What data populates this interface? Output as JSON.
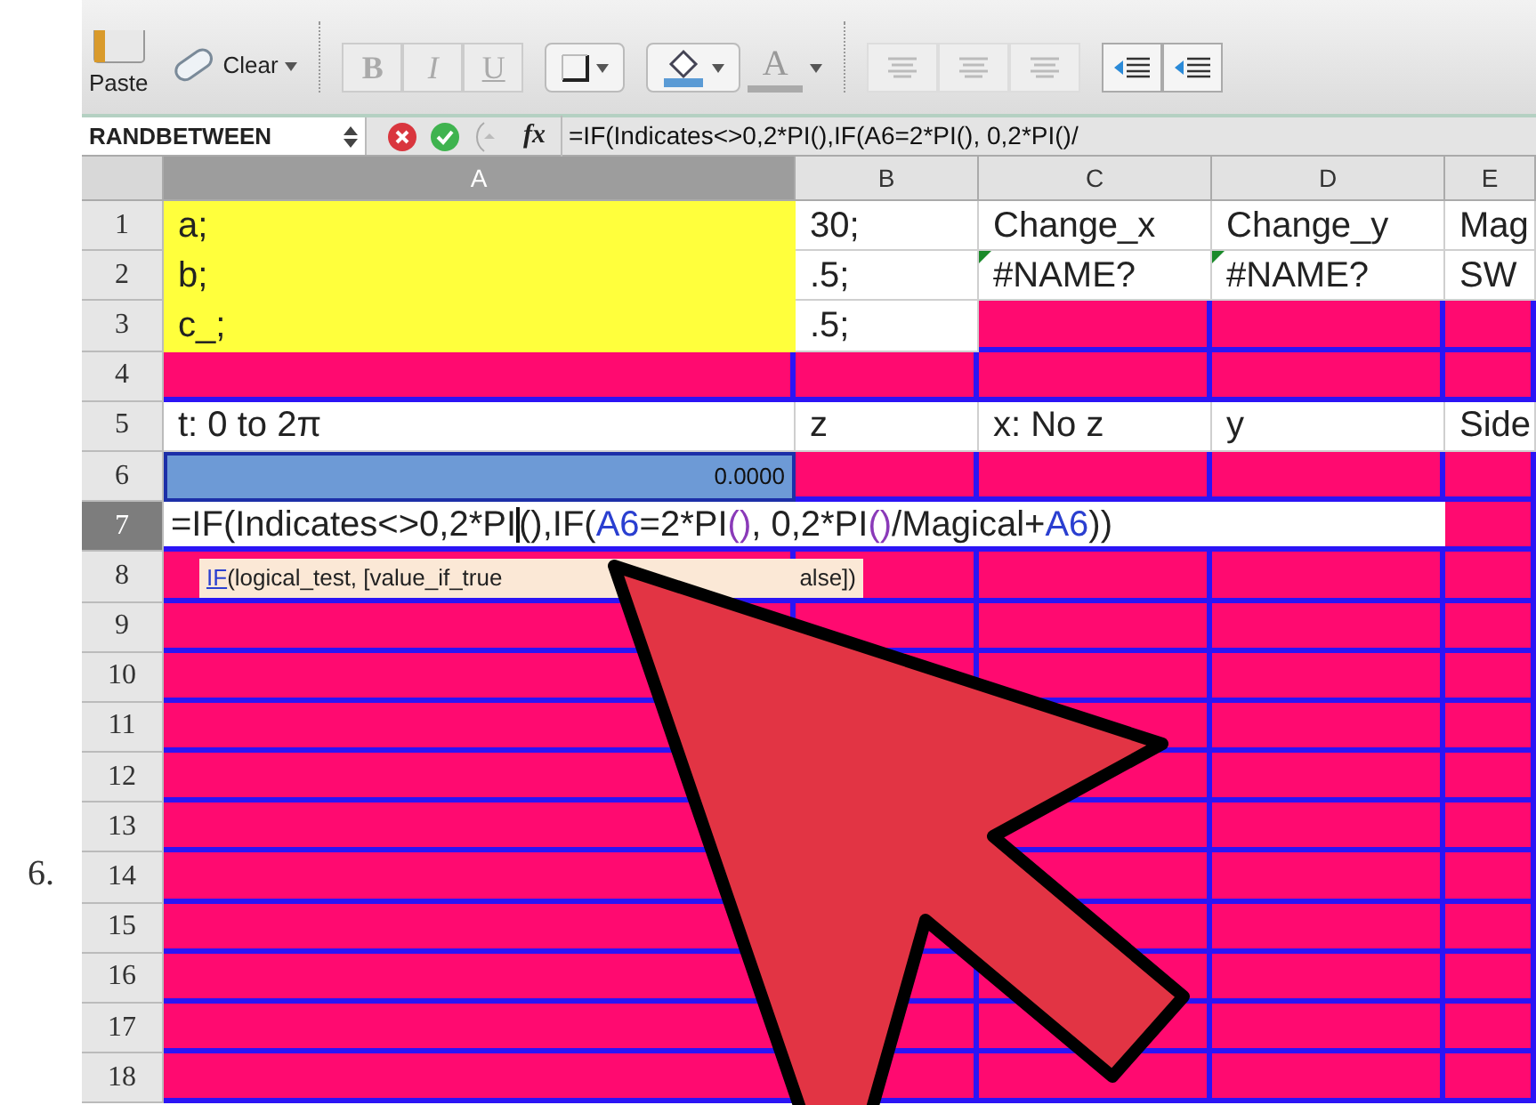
{
  "step": {
    "label": "6."
  },
  "toolbar": {
    "paste": {
      "label": "Paste"
    },
    "clear": {
      "label": "Clear"
    },
    "format_buttons": [
      "B",
      "I",
      "U"
    ],
    "font_color": {
      "label": "A"
    }
  },
  "formula_bar": {
    "name_box": "RANDBETWEEN",
    "fx": "fx",
    "formula": "=IF(Indicates<>0,2*PI(),IF(A6=2*PI(), 0,2*PI()/"
  },
  "columns": [
    {
      "label": "A",
      "selected": true
    },
    {
      "label": "B",
      "selected": false
    },
    {
      "label": "C",
      "selected": false
    },
    {
      "label": "D",
      "selected": false
    },
    {
      "label": "E",
      "selected": false
    }
  ],
  "rows": [
    {
      "number": "1",
      "selected": false,
      "cells": [
        {
          "kind": "yellow",
          "text": "a;",
          "flag": false
        },
        {
          "kind": "plain",
          "text": "30;",
          "flag": false
        },
        {
          "kind": "plain",
          "text": "Change_x",
          "flag": false
        },
        {
          "kind": "plain",
          "text": "Change_y",
          "flag": false
        },
        {
          "kind": "plain",
          "text": "Mag",
          "flag": false
        }
      ]
    },
    {
      "number": "2",
      "selected": false,
      "cells": [
        {
          "kind": "yellow",
          "text": "b;",
          "flag": false
        },
        {
          "kind": "plain",
          "text": ".5;",
          "flag": false
        },
        {
          "kind": "plain",
          "text": "#NAME?",
          "flag": true
        },
        {
          "kind": "plain",
          "text": "#NAME?",
          "flag": true
        },
        {
          "kind": "plain",
          "text": "SW",
          "flag": false
        }
      ]
    },
    {
      "number": "3",
      "selected": false,
      "cells": [
        {
          "kind": "yellow",
          "text": "c_;",
          "flag": false
        },
        {
          "kind": "plain",
          "text": ".5;",
          "flag": false
        },
        {
          "kind": "pink"
        },
        {
          "kind": "pink"
        },
        {
          "kind": "pink"
        }
      ]
    },
    {
      "number": "4",
      "selected": false,
      "cells": [
        {
          "kind": "pink"
        },
        {
          "kind": "pink"
        },
        {
          "kind": "pink"
        },
        {
          "kind": "pink"
        },
        {
          "kind": "pink"
        }
      ]
    },
    {
      "number": "5",
      "selected": false,
      "cells": [
        {
          "kind": "plain",
          "text": "t: 0 to 2π",
          "flag": false
        },
        {
          "kind": "plain",
          "text": "z",
          "flag": false
        },
        {
          "kind": "plain",
          "text": "x: No z",
          "flag": false
        },
        {
          "kind": "plain",
          "text": "y",
          "flag": false
        },
        {
          "kind": "plain",
          "text": "Side",
          "flag": false
        }
      ]
    },
    {
      "number": "6",
      "selected": false,
      "cells": [
        {
          "kind": "selected",
          "text": "0.0000"
        },
        {
          "kind": "pink"
        },
        {
          "kind": "pink"
        },
        {
          "kind": "pink"
        },
        {
          "kind": "pink"
        }
      ]
    },
    {
      "number": "7",
      "selected": true,
      "cells": [
        {
          "kind": "editor",
          "segments": [
            {
              "text": "=IF(Indicates<>0,2*PI",
              "kind": "plain"
            },
            {
              "kind": "cursor"
            },
            {
              "text": "(),IF(",
              "kind": "plain"
            },
            {
              "text": "A6",
              "kind": "ref"
            },
            {
              "text": "=2*PI",
              "kind": "plain"
            },
            {
              "text": "()",
              "kind": "paren"
            },
            {
              "text": ", 0,2*PI",
              "kind": "plain"
            },
            {
              "text": "()",
              "kind": "paren"
            },
            {
              "text": "/Magical+",
              "kind": "plain"
            },
            {
              "text": "A6",
              "kind": "ref"
            },
            {
              "text": "))",
              "kind": "plain"
            }
          ]
        },
        {
          "kind": "pink"
        }
      ]
    },
    {
      "number": "8",
      "selected": false,
      "cells": [
        {
          "kind": "pink"
        },
        {
          "kind": "pink"
        },
        {
          "kind": "pink"
        },
        {
          "kind": "pink"
        },
        {
          "kind": "pink"
        }
      ]
    },
    {
      "number": "9",
      "selected": false,
      "cells": [
        {
          "kind": "pink"
        },
        {
          "kind": "pink"
        },
        {
          "kind": "pink"
        },
        {
          "kind": "pink"
        },
        {
          "kind": "pink"
        }
      ]
    },
    {
      "number": "10",
      "selected": false,
      "cells": [
        {
          "kind": "pink"
        },
        {
          "kind": "pink"
        },
        {
          "kind": "pink"
        },
        {
          "kind": "pink"
        },
        {
          "kind": "pink"
        }
      ]
    },
    {
      "number": "11",
      "selected": false,
      "cells": [
        {
          "kind": "pink"
        },
        {
          "kind": "covered"
        },
        {
          "kind": "pink"
        },
        {
          "kind": "pink"
        },
        {
          "kind": "pink"
        }
      ]
    },
    {
      "number": "12",
      "selected": false,
      "cells": [
        {
          "kind": "pink"
        },
        {
          "kind": "covered"
        },
        {
          "kind": "pink"
        },
        {
          "kind": "pink"
        },
        {
          "kind": "pink"
        }
      ]
    },
    {
      "number": "13",
      "selected": false,
      "cells": [
        {
          "kind": "pink"
        },
        {
          "kind": "covered"
        },
        {
          "kind": "pink"
        },
        {
          "kind": "pink"
        },
        {
          "kind": "pink"
        }
      ]
    },
    {
      "number": "14",
      "selected": false,
      "cells": [
        {
          "kind": "pink"
        },
        {
          "kind": "covered"
        },
        {
          "kind": "pink"
        },
        {
          "kind": "pink"
        },
        {
          "kind": "pink"
        }
      ]
    },
    {
      "number": "15",
      "selected": false,
      "cells": [
        {
          "kind": "pink"
        },
        {
          "kind": "pink"
        },
        {
          "kind": "pink"
        },
        {
          "kind": "pink"
        },
        {
          "kind": "pink"
        }
      ]
    },
    {
      "number": "16",
      "selected": false,
      "cells": [
        {
          "kind": "pink"
        },
        {
          "kind": "pink"
        },
        {
          "kind": "pink"
        },
        {
          "kind": "pink"
        },
        {
          "kind": "pink"
        }
      ]
    },
    {
      "number": "17",
      "selected": false,
      "cells": [
        {
          "kind": "pink"
        },
        {
          "kind": "pink"
        },
        {
          "kind": "pink"
        },
        {
          "kind": "pink"
        },
        {
          "kind": "pink"
        }
      ]
    },
    {
      "number": "18",
      "selected": false,
      "cells": [
        {
          "kind": "pink"
        },
        {
          "kind": "pink"
        },
        {
          "kind": "pink"
        },
        {
          "kind": "pink"
        },
        {
          "kind": "pink"
        }
      ]
    }
  ],
  "tooltip": {
    "function": "IF",
    "arguments": "(logical_test, [value_if_true",
    "tail": "alse])"
  }
}
